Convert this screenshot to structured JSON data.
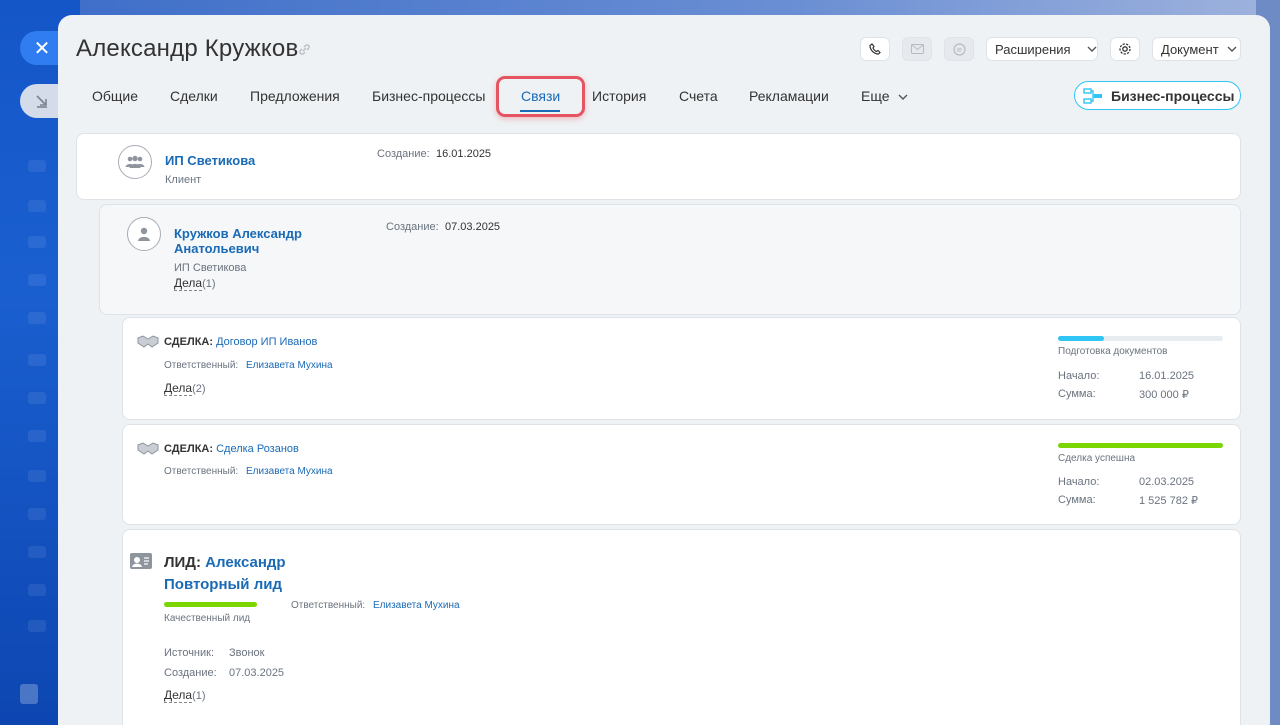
{
  "window": {
    "title": "Александр Кружков"
  },
  "toolbar": {
    "extensions_label": "Расширения",
    "document_label": "Документ"
  },
  "tabs": [
    {
      "label": "Общие"
    },
    {
      "label": "Сделки"
    },
    {
      "label": "Предложения"
    },
    {
      "label": "Бизнес-процессы"
    },
    {
      "label": "Связи",
      "active": true
    },
    {
      "label": "История"
    },
    {
      "label": "Счета"
    },
    {
      "label": "Рекламации"
    },
    {
      "label": "Еще"
    }
  ],
  "bp_button_label": "Бизнес-процессы",
  "company": {
    "name": "ИП Светикова",
    "type": "Клиент",
    "created_label": "Создание:",
    "created": "16.01.2025"
  },
  "contact": {
    "name_line1": "Кружков Александр",
    "name_line2": "Анатольевич",
    "company": "ИП Светикова",
    "tasks_label": "Дела",
    "tasks_count": "(1)",
    "created_label": "Создание:",
    "created": "07.03.2025"
  },
  "deals": [
    {
      "type_label": "СДЕЛКА:",
      "name": "Договор ИП Иванов",
      "responsible_label": "Ответственный:",
      "responsible": "Елизавета Мухина",
      "tasks_label": "Дела",
      "tasks_count": "(2)",
      "stage": "Подготовка документов",
      "stage_progress": 0.28,
      "stage_color": "#2fc6f6",
      "start_label": "Начало:",
      "start": "16.01.2025",
      "sum_label": "Сумма:",
      "sum": "300 000 ₽"
    },
    {
      "type_label": "СДЕЛКА:",
      "name": "Сделка Розанов",
      "responsible_label": "Ответственный:",
      "responsible": "Елизавета Мухина",
      "stage": "Сделка успешна",
      "stage_progress": 1.0,
      "stage_color": "#7bd500",
      "start_label": "Начало:",
      "start": "02.03.2025",
      "sum_label": "Сумма:",
      "sum": "1 525 782 ₽"
    }
  ],
  "lead": {
    "type_label": "ЛИД:",
    "name_line1": "Александр",
    "name_line2": "Повторный лид",
    "status": "Качественный лид",
    "status_color": "#7bd500",
    "responsible_label": "Ответственный:",
    "responsible": "Елизавета Мухина",
    "source_label": "Источник:",
    "source": "Звонок",
    "created_label": "Создание:",
    "created": "07.03.2025",
    "tasks_label": "Дела",
    "tasks_count": "(1)"
  }
}
